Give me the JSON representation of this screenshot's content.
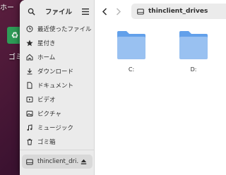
{
  "desktop": {
    "home_label": "ホー",
    "trash_label": "ゴミ"
  },
  "sidebar": {
    "title": "ファイル",
    "items": [
      {
        "label": "最近使ったファイル",
        "icon": "clock-icon"
      },
      {
        "label": "星付き",
        "icon": "star-icon"
      },
      {
        "label": "ホーム",
        "icon": "home-icon"
      },
      {
        "label": "ダウンロード",
        "icon": "download-icon"
      },
      {
        "label": "ドキュメント",
        "icon": "document-icon"
      },
      {
        "label": "ビデオ",
        "icon": "video-icon"
      },
      {
        "label": "ピクチャ",
        "icon": "picture-icon"
      },
      {
        "label": "ミュージック",
        "icon": "music-icon"
      },
      {
        "label": "ゴミ箱",
        "icon": "trash-icon"
      }
    ],
    "drive": {
      "label": "thinclient_dri…",
      "icon": "drive-icon"
    }
  },
  "main": {
    "path": "thinclient_drives",
    "folders": [
      {
        "label": "C:"
      },
      {
        "label": "D:"
      }
    ]
  },
  "colors": {
    "folder_body": "#99c1f1",
    "folder_tab": "#62a0ea",
    "sidebar_bg": "#ebebeb",
    "desktop_bg": "#3b1230"
  }
}
